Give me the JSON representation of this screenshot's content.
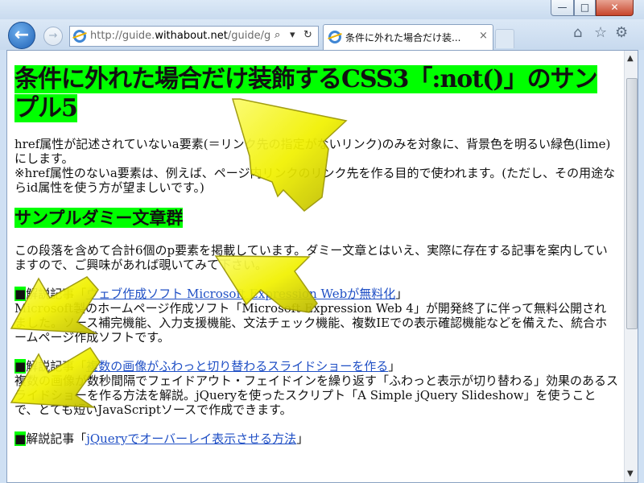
{
  "window": {
    "minimize_glyph": "—",
    "maximize_glyph": "□",
    "close_glyph": "✕"
  },
  "nav": {
    "back_glyph": "←",
    "forward_glyph": "→",
    "address_prefix": "http://guide.",
    "address_domain": "withabout.net",
    "address_suffix": "/guide/g",
    "search_glyph": "⌕",
    "dropdown_glyph": "▾",
    "refresh_glyph": "↻"
  },
  "tab": {
    "title": "条件に外れた場合だけ装...",
    "close_glyph": "×"
  },
  "toolbar": {
    "home_glyph": "⌂",
    "favorites_glyph": "☆",
    "tools_glyph": "⚙"
  },
  "page": {
    "title": "条件に外れた場合だけ装飾するCSS3「:not()」のサンプル5",
    "intro1": "href属性が記述されていないa要素(＝リンク先の指定がないリンク)のみを対象に、背景色を明るい緑色(lime)にします。",
    "intro2": "※href属性のないa要素は、例えば、ページ内リンクのリンク先を作る目的で使われます。(ただし、その用途ならid属性を使う方が望ましいです。)",
    "section_title": "サンプルダミー文章群",
    "section_intro": "この段落を含めて合計6個のp要素を掲載しています。ダミー文章とはいえ、実際に存在する記事を案内していますので、ご興味があれば覗いてみて下さい。",
    "articles": [
      {
        "marker": "■",
        "prefix": "解説記事「",
        "link": "ウェブ作成ソフト Microsoft Expression Webが無料化",
        "suffix": "」",
        "body": "Microsoft製のホームページ作成ソフト「Microsoft Expression Web 4」が開発終了に伴って無料公開されました。ソース補完機能、入力支援機能、文法チェック機能、複数IEでの表示確認機能などを備えた、統合ホームページ作成ソフトです。"
      },
      {
        "marker": "■",
        "prefix": "解説記事「",
        "link": "複数の画像がふわっと切り替わるスライドショーを作る",
        "suffix": "」",
        "body": "複数の画像が数秒間隔でフェイドアウト・フェイドインを繰り返す「ふわっと表示が切り替わる」効果のあるスライドショーを作る方法を解説。jQueryを使ったスクリプト「A Simple jQuery Slideshow」を使うことで、とても短いJavaScriptソースで作成できます。"
      },
      {
        "marker": "■",
        "prefix": "解説記事「",
        "link": "jQueryでオーバーレイ表示させる方法",
        "suffix": "」"
      }
    ]
  },
  "scrollbar": {
    "up_glyph": "▲",
    "down_glyph": "▼"
  },
  "colors": {
    "highlight": "#00ff00",
    "arrow": "#f2f200",
    "link": "#1f4fc5"
  }
}
